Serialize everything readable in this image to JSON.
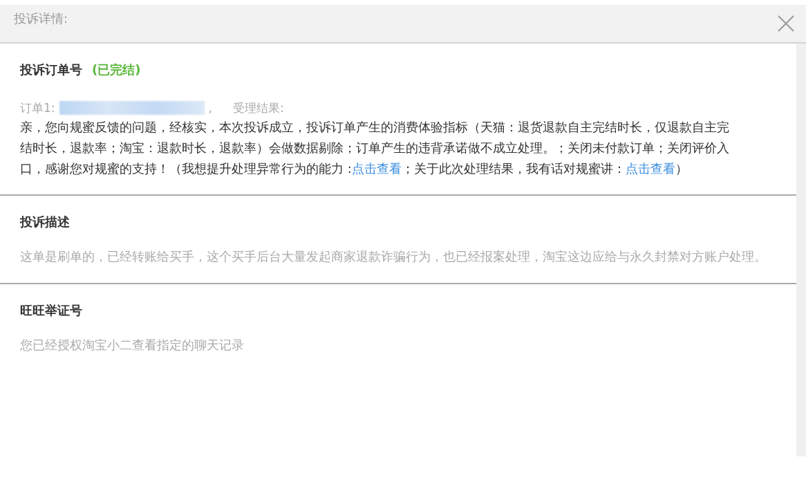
{
  "dialog": {
    "title": "投诉详情:"
  },
  "sections": [
    {
      "kind": "order",
      "heading": "投诉订单号",
      "status": "(已完结)",
      "order_label": "订单1:",
      "order_sep": ",",
      "result_label": "受理结果:",
      "result_parts": [
        {
          "kind": "text",
          "text": "亲，您向规蜜反馈的问题，经核实，本次投诉成立，投诉订单产生的消费体验指标（天猫：退货退款自主完结时长，仅退款自主完结时长，退款率；淘宝：退款时长，退款率）会做数据剔除；订单产生的违背承诺做不成立处理。；关闭未付款订单；关闭评价入口，感谢您对规蜜的支持！（我想提升处理异常行为的能力 :"
        },
        {
          "kind": "link",
          "text": "点击查看"
        },
        {
          "kind": "text",
          "text": "；关于此次处理结果，我有话对规蜜讲："
        },
        {
          "kind": "link",
          "text": "点击查看"
        },
        {
          "kind": "text",
          "text": "）"
        }
      ]
    },
    {
      "kind": "plain",
      "heading": "投诉描述",
      "body": "这单是刷单的，已经转账给买手，这个买手后台大量发起商家退款诈骗行为，也已经报案处理，淘宝这边应给与永久封禁对方账户处理。"
    },
    {
      "kind": "plain",
      "heading": "旺旺举证号",
      "body": "您已经授权淘宝小二查看指定的聊天记录"
    }
  ]
}
